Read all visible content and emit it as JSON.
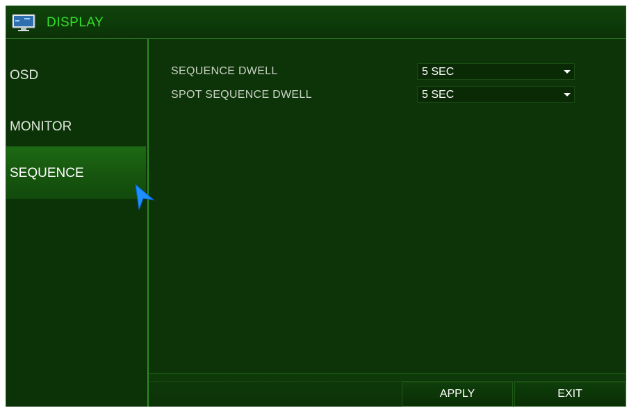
{
  "window": {
    "title": "DISPLAY",
    "title_icon": "monitor-icon"
  },
  "sidebar": {
    "items": [
      {
        "label": "OSD",
        "active": false
      },
      {
        "label": "MONITOR",
        "active": false
      },
      {
        "label": "SEQUENCE",
        "active": true
      }
    ]
  },
  "settings": {
    "rows": [
      {
        "label": "SEQUENCE DWELL",
        "value": "5 SEC"
      },
      {
        "label": "SPOT SEQUENCE DWELL",
        "value": "5 SEC"
      }
    ]
  },
  "footer": {
    "apply_label": "APPLY",
    "exit_label": "EXIT"
  },
  "colors": {
    "background": "#0d3308",
    "title_text": "#35e02a",
    "active_item": "#1d6a14",
    "cursor": "#1e8fff"
  }
}
